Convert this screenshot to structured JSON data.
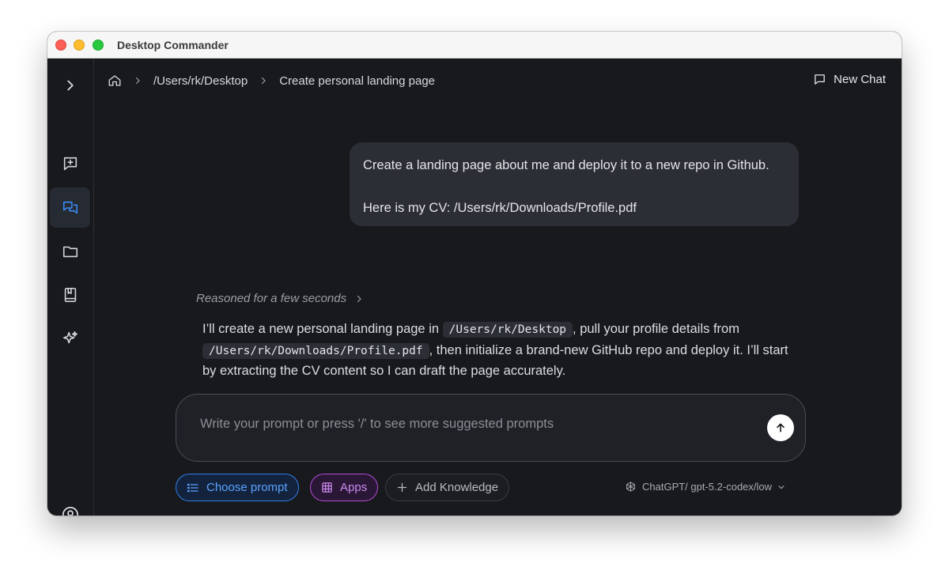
{
  "window": {
    "title": "Desktop Commander"
  },
  "sidebar": {
    "items": [
      {
        "icon": "chevron-right-icon"
      },
      {
        "icon": "new-message-icon"
      },
      {
        "icon": "chats-icon",
        "active": true
      },
      {
        "icon": "folder-icon"
      },
      {
        "icon": "knowledge-book-icon"
      },
      {
        "icon": "sparkles-icon"
      },
      {
        "icon": "user-avatar-icon"
      }
    ]
  },
  "breadcrumb": {
    "home_icon": "home-icon",
    "path": "/Users/rk/Desktop",
    "chat_title": "Create personal landing page"
  },
  "header": {
    "new_chat_label": "New Chat"
  },
  "conversation": {
    "user_message": {
      "line1": "Create a landing page about me and deploy it to a new repo in Github.",
      "line2": "Here is my CV: /Users/rk/Downloads/Profile.pdf"
    },
    "reasoning_label": "Reasoned for a few seconds",
    "assistant_message": {
      "part1": "I’ll create a new personal landing page in",
      "code1": "/Users/rk/Desktop",
      "part2": ", pull your profile details from",
      "code2": "/Users/rk/Downloads/Profile.pdf",
      "part3": ", then initialize a brand-new GitHub repo and deploy it. I’ll start by extracting the CV content so I can draft the page accurately."
    }
  },
  "composer": {
    "placeholder": "Write your prompt or press '/' to see more suggested prompts",
    "value": ""
  },
  "toolbar": {
    "choose_prompt_label": "Choose prompt",
    "apps_label": "Apps",
    "add_knowledge_label": "Add Knowledge",
    "model_label": "ChatGPT/ gpt-5.2-codex/low"
  },
  "colors": {
    "background": "#18191d",
    "accent_blue": "#2e7de9",
    "accent_purple": "#b24ad6"
  }
}
